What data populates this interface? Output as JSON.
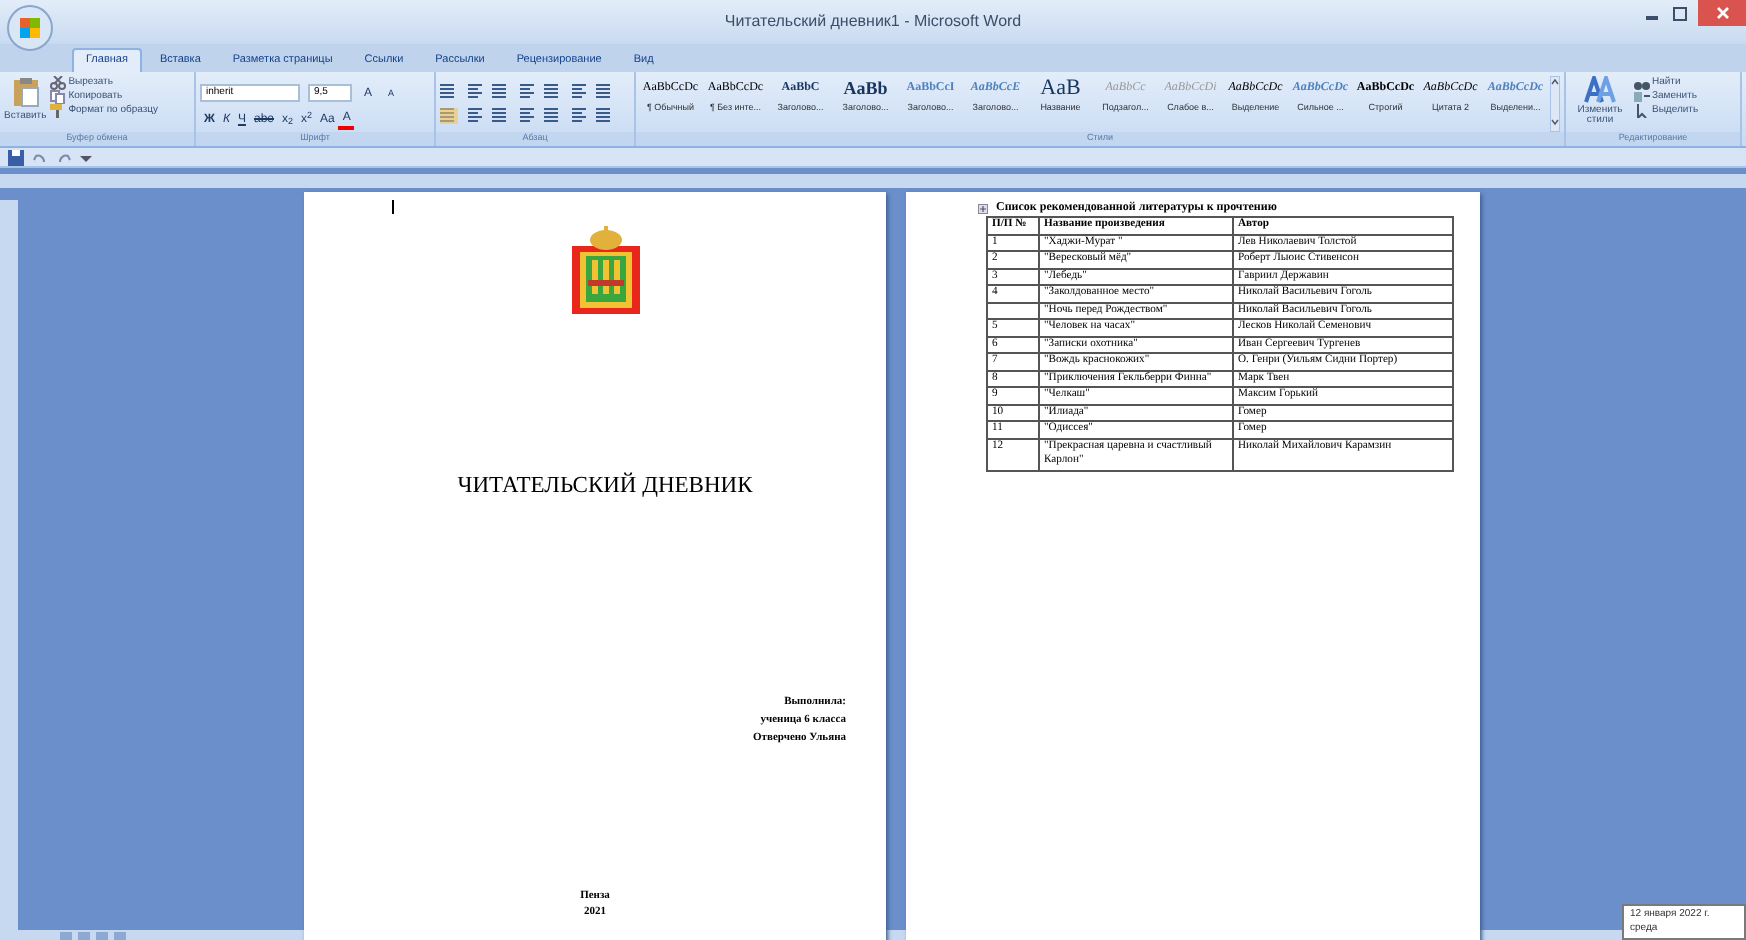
{
  "window": {
    "title": "Читательский дневник1 - Microsoft Word"
  },
  "tabs": [
    {
      "label": "Главная",
      "selected": true
    },
    {
      "label": "Вставка",
      "selected": false
    },
    {
      "label": "Разметка страницы",
      "selected": false
    },
    {
      "label": "Ссылки",
      "selected": false
    },
    {
      "label": "Рассылки",
      "selected": false
    },
    {
      "label": "Рецензирование",
      "selected": false
    },
    {
      "label": "Вид",
      "selected": false
    }
  ],
  "clipboard": {
    "paste": "Вставить",
    "cut": "Вырезать",
    "copy": "Копировать",
    "format_painter": "Формат по образцу",
    "label": "Буфер обмена"
  },
  "font": {
    "font_name": "inherit",
    "font_size": "9,5",
    "grow": "A",
    "shrink": "A",
    "format_buttons": [
      "Ж",
      "К",
      "Ч",
      "abe",
      "x$_{2}$",
      "x$^{2}$",
      "Aa"
    ],
    "font_color": "A",
    "label": "Шрифт"
  },
  "paragraph": {
    "label": "Абзац"
  },
  "styles": {
    "label": "Стили",
    "change_styles": "Изменить стили",
    "items": [
      {
        "preview": "AaBbCcDc",
        "name": "¶ Обычный",
        "kind": "body"
      },
      {
        "preview": "AaBbCcDc",
        "name": "¶ Без инте...",
        "kind": "body"
      },
      {
        "preview": "AaBbC",
        "name": "Заголово...",
        "kind": "heading"
      },
      {
        "preview": "AaBb",
        "name": "Заголово...",
        "kind": "heading-large"
      },
      {
        "preview": "AaBbCcI",
        "name": "Заголово...",
        "kind": "subheading"
      },
      {
        "preview": "AaBbCcE",
        "name": "Заголово...",
        "kind": "subheading-italic"
      },
      {
        "preview": "AaB",
        "name": "Название",
        "kind": "title"
      },
      {
        "preview": "AaBbCc",
        "name": "Подзагол...",
        "kind": "subtle"
      },
      {
        "preview": "AaBbCcDi",
        "name": "Слабое в...",
        "kind": "subtle"
      },
      {
        "preview": "AaBbCcDc",
        "name": "Выделение",
        "kind": "emphasis"
      },
      {
        "preview": "AaBbCcDc",
        "name": "Сильное ...",
        "kind": "strong-emphasis"
      },
      {
        "preview": "AaBbCcDc",
        "name": "Строгий",
        "kind": "strong"
      },
      {
        "preview": "AaBbCcDc",
        "name": "Цитата 2",
        "kind": "quote"
      },
      {
        "preview": "AaBbCcDc",
        "name": "Выделени...",
        "kind": "intense-quote"
      }
    ]
  },
  "editing": {
    "find": "Найти",
    "replace": "Заменить",
    "select": "Выделить",
    "label": "Редактирование"
  },
  "cover_page": {
    "title": "ЧИТАТЕЛЬСКИЙ ДНЕВНИК",
    "signature": [
      "Выполнила:",
      "ученица 6 класса",
      "Отверчено Ульяна"
    ],
    "city": "Пенза",
    "year": "2021"
  },
  "list_page": {
    "heading": "Список рекомендованной литературы к прочтению",
    "columns": [
      "П/П №",
      "Название произведения",
      "Автор"
    ],
    "rows": [
      [
        "1",
        "\"Хаджи-Мурат \"",
        "Лев Николаевич Толстой"
      ],
      [
        "2",
        "\"Вересковый мёд\"",
        "Роберт Льюис Стивенсон"
      ],
      [
        "3",
        "\"Лебедь\"",
        "Гавриил Державин"
      ],
      [
        "4",
        "\"Заколдованное место\"",
        "Николай Васильевич Гоголь"
      ],
      [
        "",
        "\"Ночь перед Рождеством\"",
        "Николай Васильевич Гоголь"
      ],
      [
        "5",
        "\"Человек на часах\"",
        "Лесков Николай Семенович"
      ],
      [
        "6",
        "\"Записки охотника\"",
        "Иван Сергеевич Тургенев"
      ],
      [
        "7",
        "\"Вождь краснокожих\"",
        "О. Генри (Уильям Сидни Портер)"
      ],
      [
        "8",
        "\"Приключения Гекльберри Финна\"",
        "Марк Твен"
      ],
      [
        "9",
        "\"Челкаш\"",
        "Максим Горький"
      ],
      [
        "10",
        "\"Илиада\"",
        "Гомер"
      ],
      [
        "11",
        "\"Одиссея\"",
        "Гомер"
      ],
      [
        "12",
        "\"Прекрасная царевна и счастливый Карлон\"",
        "Николай Михайлович Карамзин"
      ]
    ]
  },
  "tooltip": {
    "date": "12 января 2022 г.",
    "weekday": "среда"
  }
}
